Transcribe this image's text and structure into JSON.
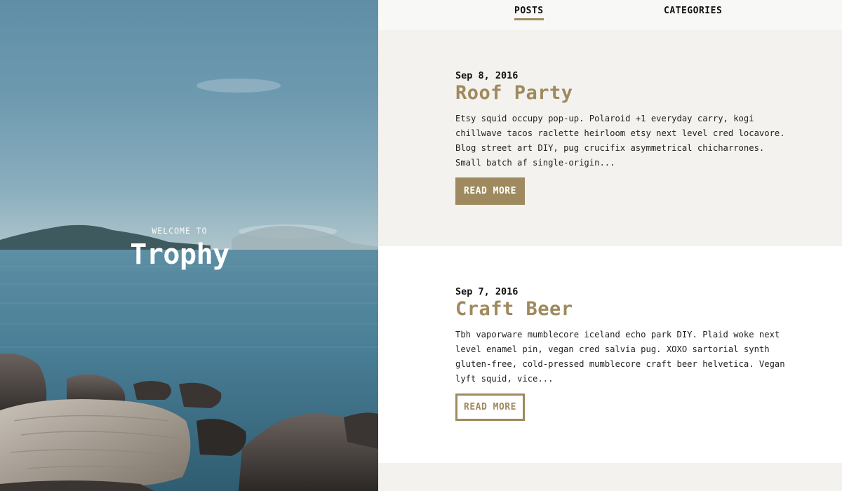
{
  "hero": {
    "kicker": "WELCOME TO",
    "title": "Trophy"
  },
  "nav": {
    "items": [
      {
        "label": "POSTS",
        "active": true
      },
      {
        "label": "CATEGORIES",
        "active": false
      }
    ]
  },
  "posts": [
    {
      "date": "Sep 8, 2016",
      "title": "Roof Party",
      "excerpt": "Etsy squid occupy pop-up. Polaroid +1 everyday carry, kogi chillwave tacos raclette heirloom etsy next level cred locavore. Blog street art DIY, pug crucifix asymmetrical chicharrones. Small batch af single-origin...",
      "read_more": "READ MORE"
    },
    {
      "date": "Sep 7, 2016",
      "title": "Craft Beer",
      "excerpt": "Tbh vaporware mumblecore iceland echo park DIY. Plaid woke next level enamel pin, vegan cred salvia pug. XOXO sartorial synth gluten-free, cold-pressed mumblecore craft beer helvetica. Vegan lyft squid, vice...",
      "read_more": "READ MORE"
    }
  ],
  "colors": {
    "accent": "#9e8a5e",
    "post_bg_alt": "#f4f2ee",
    "nav_bg": "#f8f8f7"
  }
}
